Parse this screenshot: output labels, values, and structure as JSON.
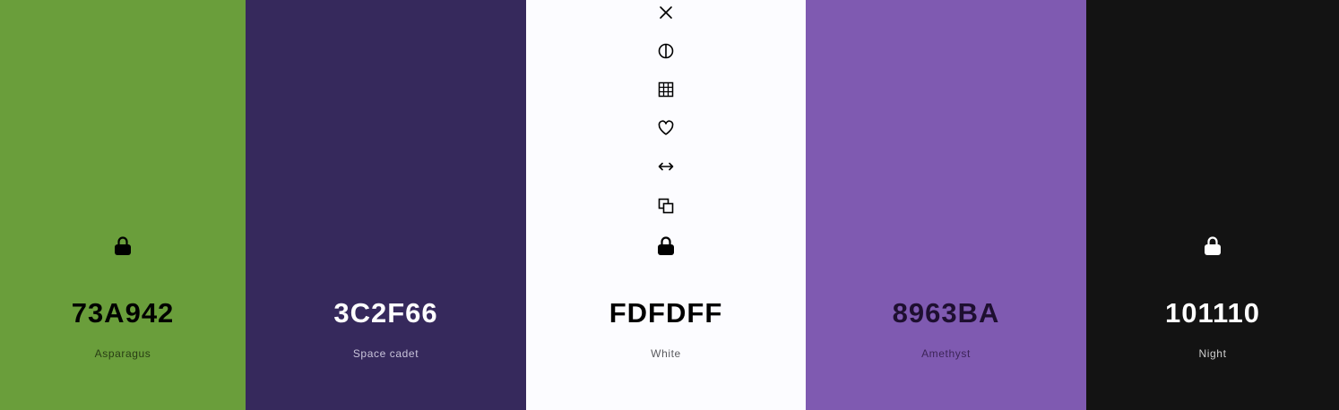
{
  "swatches": [
    {
      "hex": "73A942",
      "name": "Asparagus",
      "color": "#6a9e3b",
      "text_color": "#000000",
      "name_color": "#283d14",
      "locked": true,
      "icon": "lock-icon"
    },
    {
      "hex": "3C2F66",
      "name": "Space cadet",
      "color": "#36295c",
      "text_color": "#ffffff",
      "name_color": "#c9c4da",
      "locked": false
    },
    {
      "hex": "FDFDFF",
      "name": "White",
      "color": "#fcfcff",
      "text_color": "#000000",
      "name_color": "#5a5a5e",
      "locked": true,
      "icon": "lock-icon"
    },
    {
      "hex": "8963BA",
      "name": "Amethyst",
      "color": "#7f5ab1",
      "text_color": "#1e0f30",
      "name_color": "#3c2458",
      "locked": false
    },
    {
      "hex": "101110",
      "name": "Night",
      "color": "#131313",
      "text_color": "#ffffff",
      "name_color": "#cfcfcf",
      "locked": true,
      "icon": "lock-icon"
    }
  ],
  "toolbar": {
    "icons": [
      "close-icon",
      "contrast-icon",
      "grid-icon",
      "heart-icon",
      "arrows-horizontal-icon",
      "copy-icon",
      "lock-icon"
    ]
  }
}
